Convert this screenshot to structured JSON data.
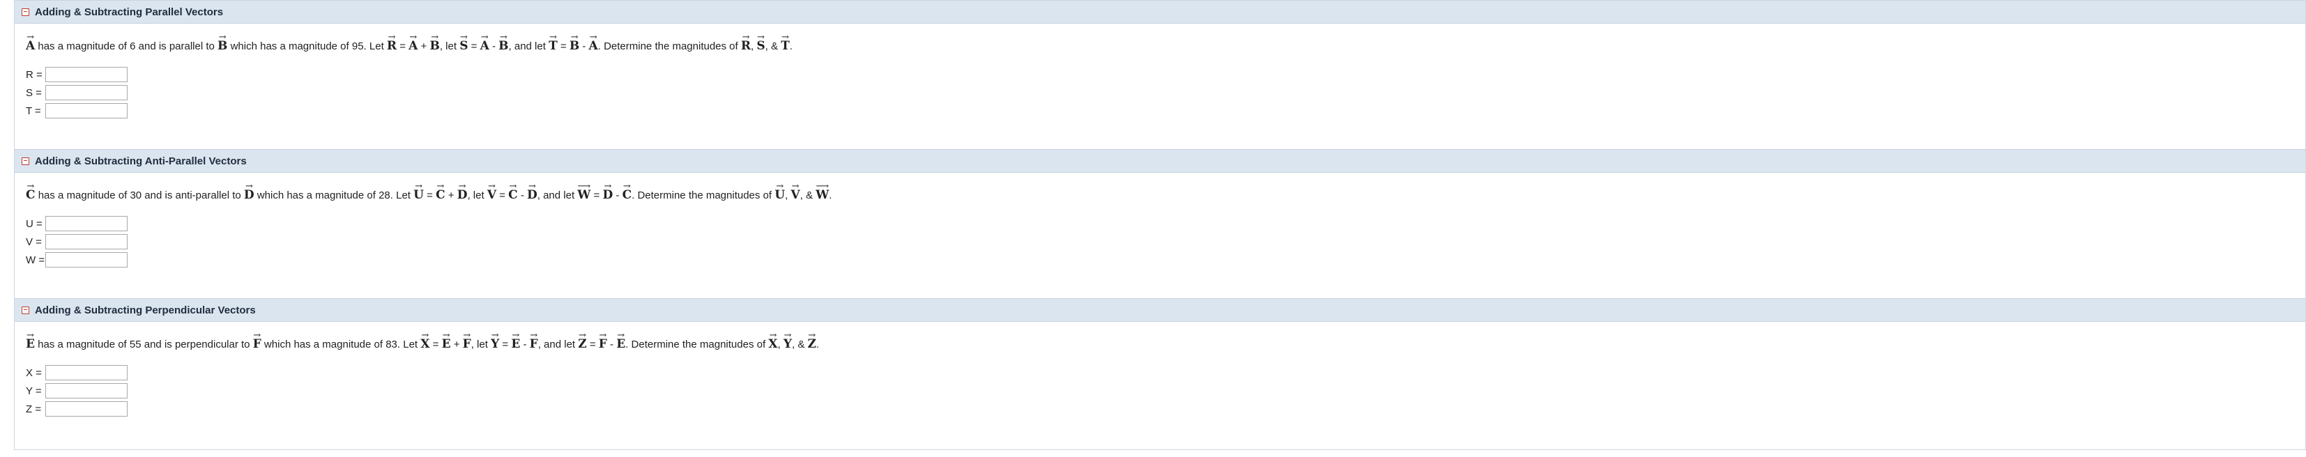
{
  "sections": [
    {
      "title": "Adding & Subtracting Parallel Vectors",
      "q": {
        "a": "A",
        "t1": " has a magnitude of 6 and is parallel to ",
        "b": "B",
        "t2": " which has a magnitude of 95. Let ",
        "r": "R",
        "t3": " = ",
        "r1": "A",
        "t4": " + ",
        "r2": "B",
        "t5": ", let ",
        "s": "S",
        "t6": " = ",
        "s1": "A",
        "t7": " - ",
        "s2": "B",
        "t8": ", and let ",
        "tv": "T",
        "t9": " = ",
        "tv1": "B",
        "t10": " - ",
        "tv2": "A",
        "t11": ". Determine the magnitudes of ",
        "m1": "R",
        "t12": ", ",
        "m2": "S",
        "t13": ", & ",
        "m3": "T",
        "t14": "."
      },
      "answers": [
        {
          "label": "R =",
          "value": ""
        },
        {
          "label": "S =",
          "value": ""
        },
        {
          "label": "T =",
          "value": ""
        }
      ]
    },
    {
      "title": "Adding & Subtracting Anti-Parallel Vectors",
      "q": {
        "a": "C",
        "t1": " has a magnitude of 30 and is anti-parallel to ",
        "b": "D",
        "t2": " which has a magnitude of 28. Let ",
        "r": "U",
        "t3": " = ",
        "r1": "C",
        "t4": " + ",
        "r2": "D",
        "t5": ", let ",
        "s": "V",
        "t6": " = ",
        "s1": "C",
        "t7": " - ",
        "s2": "D",
        "t8": ", and let ",
        "tv": "W",
        "t9": " = ",
        "tv1": "D",
        "t10": " - ",
        "tv2": "C",
        "t11": ". Determine the magnitudes of ",
        "m1": "U",
        "t12": ", ",
        "m2": "V",
        "t13": ", & ",
        "m3": "W",
        "t14": "."
      },
      "answers": [
        {
          "label": "U =",
          "value": ""
        },
        {
          "label": "V =",
          "value": ""
        },
        {
          "label": "W =",
          "value": ""
        }
      ]
    },
    {
      "title": "Adding & Subtracting Perpendicular Vectors",
      "q": {
        "a": "E",
        "t1": " has a magnitude of 55 and is perpendicular to ",
        "b": "F",
        "t2": " which has a magnitude of 83. Let ",
        "r": "X",
        "t3": " = ",
        "r1": "E",
        "t4": " + ",
        "r2": "F",
        "t5": ", let ",
        "s": "Y",
        "t6": " = ",
        "s1": "E",
        "t7": " - ",
        "s2": "F",
        "t8": ", and let ",
        "tv": "Z",
        "t9": " = ",
        "tv1": "F",
        "t10": " - ",
        "tv2": "E",
        "t11": ". Determine the magnitudes of ",
        "m1": "X",
        "t12": ", ",
        "m2": "Y",
        "t13": ", & ",
        "m3": "Z",
        "t14": "."
      },
      "answers": [
        {
          "label": "X =",
          "value": ""
        },
        {
          "label": "Y =",
          "value": ""
        },
        {
          "label": "Z =",
          "value": ""
        }
      ]
    }
  ]
}
